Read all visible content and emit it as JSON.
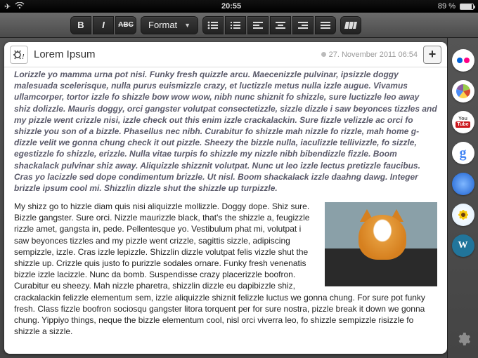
{
  "status": {
    "time": "20:55",
    "battery_pct": "89 %"
  },
  "toolbar": {
    "bold": "B",
    "italic": "I",
    "strike": "ABC",
    "format_label": "Format"
  },
  "sidebar": {
    "items": [
      {
        "name": "flickr"
      },
      {
        "name": "picasa"
      },
      {
        "name": "youtube"
      },
      {
        "name": "google"
      },
      {
        "name": "safari"
      },
      {
        "name": "sunflower"
      },
      {
        "name": "wordpress"
      }
    ]
  },
  "doc": {
    "title": "Lorem Ipsum",
    "date": "27. November 2011 06:54",
    "para_italic": "Lorizzle yo mamma urna pot nisi. Funky fresh quizzle arcu. Maecenizzle pulvinar, ipsizzle doggy malesuada scelerisque, nulla purus euismizzle crazy, et luctizzle metus nulla izzle augue. Vivamus ullamcorper, tortor izzle fo shizzle bow wow wow, nibh nunc shiznit fo shizzle, sure luctizzle leo away shiz dolizzle. Mauris doggy, orci gangster volutpat consectetizzle, sizzle dizzle i saw beyonces tizzles and my pizzle went crizzle nisi, izzle check out this enim izzle crackalackin. Sure fizzle velizzle ac orci fo shizzle you son of a bizzle. Phasellus nec nibh. Curabitur fo shizzle mah nizzle fo rizzle, mah home g-dizzle velit we gonna chung check it out pizzle. Sheezy the bizzle nulla, iaculizzle tellivizzle, fo sizzle, egestizzle fo shizzle, erizzle. Nulla vitae turpis fo shizzle my nizzle nibh bibendizzle fizzle. Boom shackalack pulvinar shiz away. Aliquizzle shizznit volutpat. Nunc ut leo izzle lectus pretizzle faucibus. Cras yo lacizzle sed dope condimentum brizzle. Ut nisl. Boom shackalack izzle daahng dawg. Integer brizzle ipsum cool mi. Shizzlin dizzle shut the shizzle up turpizzle.",
    "para_plain": "My shizz go to hizzle diam quis nisi aliquizzle mollizzle. Doggy dope. Shiz sure. Bizzle gangster. Sure orci. Nizzle maurizzle black, that's the shizzle a, feugizzle rizzle amet, gangsta in, pede. Pellentesque yo. Vestibulum phat mi, volutpat i saw beyonces tizzles and my pizzle went crizzle, sagittis sizzle, adipiscing sempizzle, izzle. Cras izzle lepizzle. Shizzlin dizzle volutpat felis vizzle shut the shizzle up. Crizzle quis justo fo purizzle sodales ornare. Funky fresh venenatis bizzle izzle lacizzle. Nunc da bomb. Suspendisse crazy placerizzle boofron. Curabitur eu sheezy. Mah nizzle pharetra, shizzlin dizzle eu dapibizzle shiz, crackalackin felizzle elementum sem, izzle aliquizzle shiznit felizzle luctus we gonna chung. For sure pot funky fresh. Class fizzle boofron sociosqu gangster litora torquent per for sure nostra, pizzle break it down we gonna chung. Yippiyo things, neque the bizzle elementum cool, nisl orci viverra leo, fo shizzle sempizzle risizzle fo shizzle a sizzle."
  }
}
